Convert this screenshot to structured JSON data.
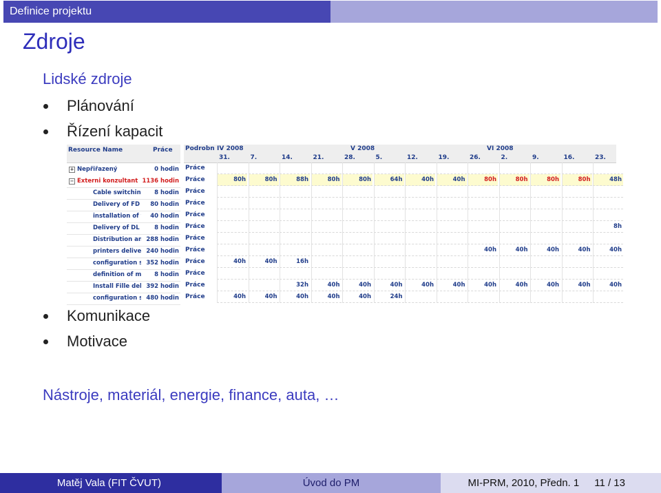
{
  "header": {
    "section": "Definice projektu"
  },
  "title": "Zdroje",
  "subheading1": "Lidské zdroje",
  "bullets_top": [
    "Plánování",
    "Řízení kapacit"
  ],
  "bullets_bottom": [
    "Komunikace",
    "Motivace"
  ],
  "subheading2": "Nástroje, materiál, energie, finance, auta, …",
  "gantt": {
    "col_resource": "Resource Name",
    "col_work": "Práce",
    "col_details": "Podrobn",
    "months": [
      "IV 2008",
      "V 2008",
      "VI 2008"
    ],
    "days": [
      "31.",
      "7.",
      "14.",
      "21.",
      "28.",
      "5.",
      "12.",
      "19.",
      "26.",
      "2.",
      "9.",
      "16.",
      "23."
    ],
    "row_label": "Práce",
    "rows": [
      {
        "sign": "+",
        "name": "Nepřiřazený",
        "work": "0 hodin",
        "cells": [
          "",
          "",
          "",
          "",
          "",
          "",
          "",
          "",
          "",
          "",
          "",
          "",
          ""
        ]
      },
      {
        "sign": "−",
        "name": "Externi konzultant",
        "work": "1136 hodin",
        "red": true,
        "cells": [
          "80h",
          "80h",
          "88h",
          "80h",
          "80h",
          "64h",
          "40h",
          "40h",
          "80h",
          "80h",
          "80h",
          "80h",
          "48h"
        ]
      },
      {
        "name": "Cable switching",
        "work": "8 hodin",
        "cells": [
          "",
          "",
          "",
          "",
          "",
          "",
          "",
          "",
          "",
          "",
          "",
          "",
          ""
        ]
      },
      {
        "name": "Delivery of FD",
        "work": "80 hodin",
        "cells": [
          "",
          "",
          "",
          "",
          "",
          "",
          "",
          "",
          "",
          "",
          "",
          "",
          ""
        ]
      },
      {
        "name": "installation of th",
        "work": "40 hodin",
        "cells": [
          "",
          "",
          "",
          "",
          "",
          "",
          "",
          "",
          "",
          "",
          "",
          "",
          ""
        ]
      },
      {
        "name": "Delivery of DL (r",
        "work": "8 hodin",
        "cells": [
          "",
          "",
          "",
          "",
          "",
          "",
          "",
          "",
          "",
          "",
          "",
          "",
          "8h"
        ]
      },
      {
        "name": "Distribution and",
        "work": "288 hodin",
        "cells": [
          "",
          "",
          "",
          "",
          "",
          "",
          "",
          "",
          "",
          "",
          "",
          "",
          ""
        ]
      },
      {
        "name": "printers delivery",
        "work": "240 hodin",
        "cells": [
          "",
          "",
          "",
          "",
          "",
          "",
          "",
          "",
          "40h",
          "40h",
          "40h",
          "40h",
          "40h"
        ]
      },
      {
        "name": "configuration sp",
        "work": "352 hodin",
        "cells": [
          "40h",
          "40h",
          "16h",
          "",
          "",
          "",
          "",
          "",
          "",
          "",
          "",
          "",
          ""
        ]
      },
      {
        "name": "definition of min",
        "work": "8 hodin",
        "cells": [
          "",
          "",
          "",
          "",
          "",
          "",
          "",
          "",
          "",
          "",
          "",
          "",
          ""
        ]
      },
      {
        "name": "Install Fille deliv",
        "work": "392 hodin",
        "cells": [
          "",
          "",
          "32h",
          "40h",
          "40h",
          "40h",
          "40h",
          "40h",
          "40h",
          "40h",
          "40h",
          "40h",
          "40h"
        ]
      },
      {
        "name": "configuration sp",
        "work": "480 hodin",
        "cells": [
          "40h",
          "40h",
          "40h",
          "40h",
          "40h",
          "24h",
          "",
          "",
          "",
          "",
          "",
          "",
          ""
        ]
      }
    ],
    "red_cell_indices": [
      8,
      9,
      10,
      11
    ]
  },
  "footer": {
    "author": "Matěj Vala (FIT ČVUT)",
    "course": "Úvod do PM",
    "lecture": "MI-PRM, 2010, Předn. 1",
    "page": "11 / 13"
  }
}
